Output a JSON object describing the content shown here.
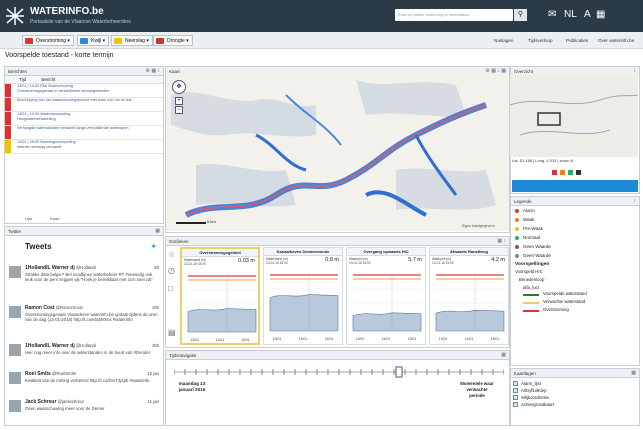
{
  "header": {
    "brand": "WATERINFO.be",
    "tagline": "Portaalsite van de Vlaamse Waterbeheerders",
    "search_placeholder": "Zoek op straat, waterloop of meetstation...",
    "lang": "NL",
    "font": "A",
    "mail_icon": "mail-icon",
    "grid_icon": "grid-icon"
  },
  "toolbar": {
    "buttons": [
      {
        "label": "Overstroming",
        "color": "#d93333"
      },
      {
        "label": "Kwijl",
        "color": "#2b8ad6"
      },
      {
        "label": "Neerslag",
        "color": "#f0c300"
      },
      {
        "label": "Droogte",
        "color": "#c0392b"
      }
    ],
    "right": [
      "Naslagen",
      "Tijdsverloop",
      "Publicaties",
      "Over waterinfo.be"
    ]
  },
  "page_title": "Voorspelde toestand - korte termijn",
  "panels": {
    "berichten": "Berichten",
    "kaart": "Kaart",
    "overzicht": "Overzicht",
    "twitter": "Twitter",
    "grafieken": "Grafieken",
    "legende": "Legende",
    "tijdsnavigatie": "Tijdsnavigatie",
    "kaartlagen": "Kaartlagen"
  },
  "berichten": {
    "headers": [
      "Tijd",
      "Bericht"
    ],
    "items": [
      {
        "time": "13/01 | 14:00 RMI Waarschuwing",
        "text": "Overstromingsgevaar in verschillende stroomgebieden",
        "color": "#d93333"
      },
      {
        "time": "",
        "text": "Beschrijving van het waarschuwingsbericht met meer info via de link",
        "color": "#d93333"
      },
      {
        "time": "13/01 | 10:00 Waterverwachting",
        "text": "Hoogwaterverwachting",
        "color": "#d93333"
      },
      {
        "time": "",
        "text": "Verhoogde waterstanden verwacht langs verschillende waterlopen",
        "color": "#d93333"
      },
      {
        "time": "13/01 | 09:00 Neerslagvoorspelling",
        "text": "Intense neerslag verwacht",
        "color": "#f0c300"
      }
    ],
    "footer_left": "Lijst",
    "footer_right": "Kaart"
  },
  "map": {
    "scale": "5 km",
    "attribution": "Eigen kaartgegevens"
  },
  "overview": {
    "coords": "Lat. 51.165 | Long. 4.013 | zoom 8"
  },
  "twitter": {
    "title": "Tweets",
    "tweets": [
      {
        "name": "1HollandlL Warner dj",
        "handle": "@Hollandi",
        "time": "5h",
        "text": "Strakke data belgie? Bel noodlijnen waterbeheer RT #oneindig ook leuk voor de pers zeggen wij \"Hoek je bereikbaar met zo'n snel zal\""
      },
      {
        "name": "Ramon Cost",
        "handle": "@RamonCost",
        "time": "15h",
        "text": "Overstromingsgevaar Vlaanderen waterinfo.be update tijdens de uren van de dag (13-01-2016) http://t.co/Klabh0rnx #waterinfo"
      },
      {
        "name": "1HollandlL Warner dj",
        "handle": "@Hollandi",
        "time": "15h",
        "text": "Hier nog meer info over de waterstanden in de buurt van #Dender"
      },
      {
        "name": "Roel Smits",
        "handle": "@RoelSmits",
        "time": "12 jan",
        "text": "Kwaliteit van de meting verbeterd http://t.co/lmsT3j4pb #waterinfo"
      },
      {
        "name": "Jack Schreur",
        "handle": "@jackschreur",
        "time": "11 jan",
        "text": "Geen waarschuwing meer voor de Demer"
      }
    ]
  },
  "charts": [
    {
      "title": "Overstromingsgebied",
      "meta": [
        "Waterstand (m)",
        "13-01-16 15:00"
      ],
      "value": "0.03 m",
      "xticks": [
        "13/01",
        "14/01",
        "15/01"
      ],
      "level": 0.45,
      "selected": true
    },
    {
      "title": "Kanaalhaven Dendermonde",
      "meta": [
        "Waterstand (m)",
        "13-01-16 15:00"
      ],
      "value": "0.8 m",
      "xticks": [
        "13/01",
        "14/01",
        "15/01"
      ],
      "level": 0.7,
      "selected": false
    },
    {
      "title": "Overgang opwaarts HIC",
      "meta": [
        "Waterpeil (m)",
        "13-01-16 15:00"
      ],
      "value": "5.7 m",
      "xticks": [
        "13/01",
        "14/01",
        "15/01"
      ],
      "level": 0.35,
      "selected": false
    },
    {
      "title": "Afwaarts Ranstbrug",
      "meta": [
        "Waterpeil (m)",
        "13-01-16 15:00"
      ],
      "value": "4.2 m",
      "xticks": [
        "13/01",
        "14/01",
        "15/01"
      ],
      "level": 0.4,
      "selected": false
    }
  ],
  "legend": {
    "levels": [
      {
        "label": "Alarm",
        "color": "#d93333"
      },
      {
        "label": "Waak",
        "color": "#e67e22"
      },
      {
        "label": "Pre-Waak",
        "color": "#f1c40f"
      },
      {
        "label": "Normaal",
        "color": "#27ae60"
      },
      {
        "label": "Geen Waarde",
        "color": "#8e44ad"
      },
      {
        "label": "Geen Waarde",
        "color": "#7f8c8d"
      }
    ],
    "section": "Voorspellingen",
    "sub": "Voorspeld HIC",
    "sub2": "Benedenloop",
    "sub3": "alfa_lucl",
    "lines": [
      {
        "label": "Voorspelde waterstand",
        "color": "#2a7a2a"
      },
      {
        "label": "Verwachte waterstand",
        "color": "#e6d16a"
      },
      {
        "label": "Overstroming",
        "color": "#d93333"
      }
    ]
  },
  "timenav": {
    "date": "maandag 13 januari 2016",
    "right": "Momentele waar verwachte periode"
  },
  "layers": [
    "Alarm_lijst",
    "AllGyfluitKlep",
    "Wiljkoordenten",
    "Achtergrondkaart"
  ]
}
